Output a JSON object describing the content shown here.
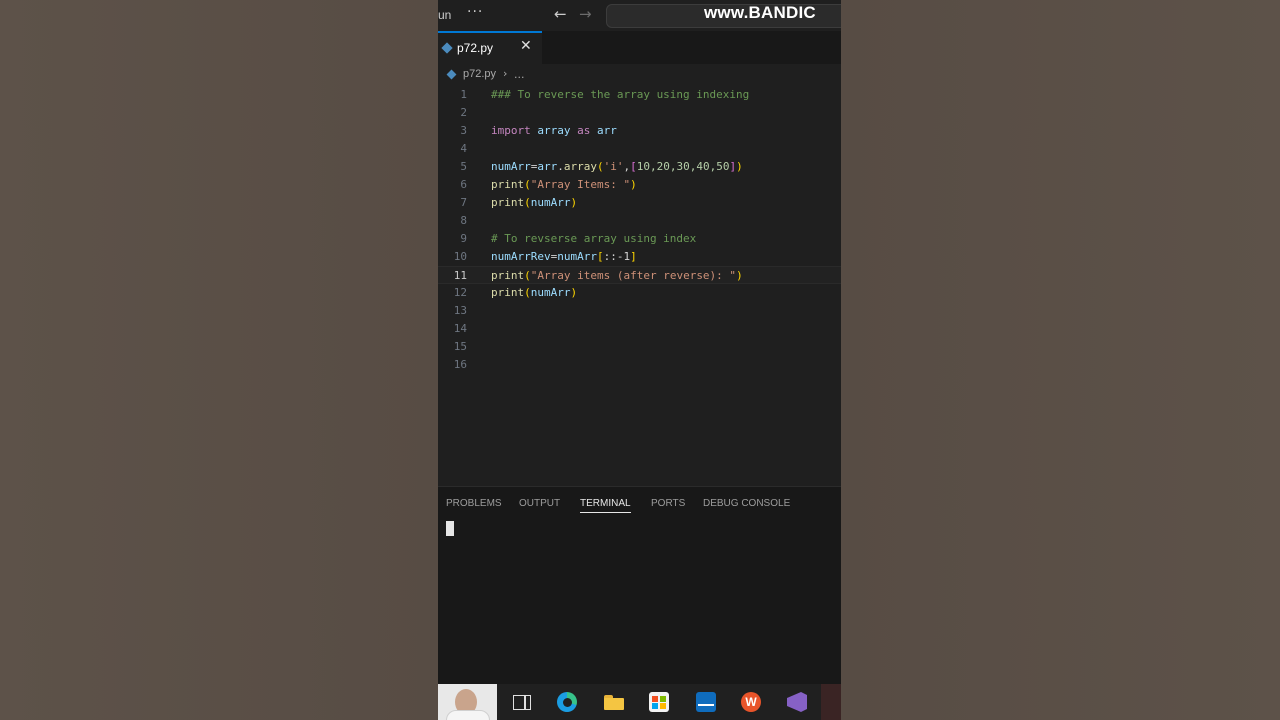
{
  "titlebar": {
    "run_label": "un",
    "more_glyph": "···",
    "back_glyph": "←",
    "forward_glyph": "→",
    "watermark": "www.BANDIC"
  },
  "tab": {
    "label": "p72.py",
    "close_glyph": "✕"
  },
  "breadcrumb": {
    "file": "p72.py",
    "separator": "›",
    "more": "..."
  },
  "editor": {
    "current_line": 11,
    "line_numbers": [
      "1",
      "2",
      "3",
      "4",
      "5",
      "6",
      "7",
      "8",
      "9",
      "10",
      "11",
      "12",
      "13",
      "14",
      "15",
      "16"
    ],
    "code": {
      "l1": "### To reverse the array using indexing",
      "l3_kw": "import",
      "l3_mod": "array",
      "l3_as": "as",
      "l3_alias": "arr",
      "l5_var": "numArr",
      "l5_eq": "=",
      "l5_mod": "arr",
      "l5_dot": ".",
      "l5_fn": "array",
      "l5_open": "(",
      "l5_str": "'i'",
      "l5_comma": ",",
      "l5_lb": "[",
      "l5_nums": "10,20,30,40,50",
      "l5_rb": "]",
      "l5_close": ")",
      "l6_fn": "print",
      "l6_open": "(",
      "l6_str": "\"Array Items: \"",
      "l6_close": ")",
      "l7_fn": "print",
      "l7_open": "(",
      "l7_var": "numArr",
      "l7_close": ")",
      "l9": "# To revserse array using index",
      "l10_var": "numArrRev",
      "l10_eq": "=",
      "l10_src": "numArr",
      "l10_lb": "[",
      "l10_slice": "::-1",
      "l10_rb": "]",
      "l11_fn": "print",
      "l11_open": "(",
      "l11_str": "\"Array items (after reverse): \"",
      "l11_close": ")",
      "l12_fn": "print",
      "l12_open": "(",
      "l12_var": "numArr",
      "l12_close": ")"
    }
  },
  "panel": {
    "tabs": [
      "PROBLEMS",
      "OUTPUT",
      "TERMINAL",
      "PORTS",
      "DEBUG CONSOLE"
    ],
    "active_tab": "TERMINAL"
  },
  "taskbar": {
    "office_letter": "W",
    "icons": [
      "user-avatar",
      "task-view-icon",
      "edge-icon",
      "file-explorer-icon",
      "store-icon",
      "mail-icon",
      "office-icon",
      "visual-studio-icon"
    ]
  },
  "colors": {
    "accent": "#0078d4",
    "comment": "#6a9955",
    "keyword": "#c586c0",
    "variable": "#9cdcfe",
    "function": "#dcdcaa",
    "string": "#ce9178",
    "number": "#b5cea8"
  }
}
